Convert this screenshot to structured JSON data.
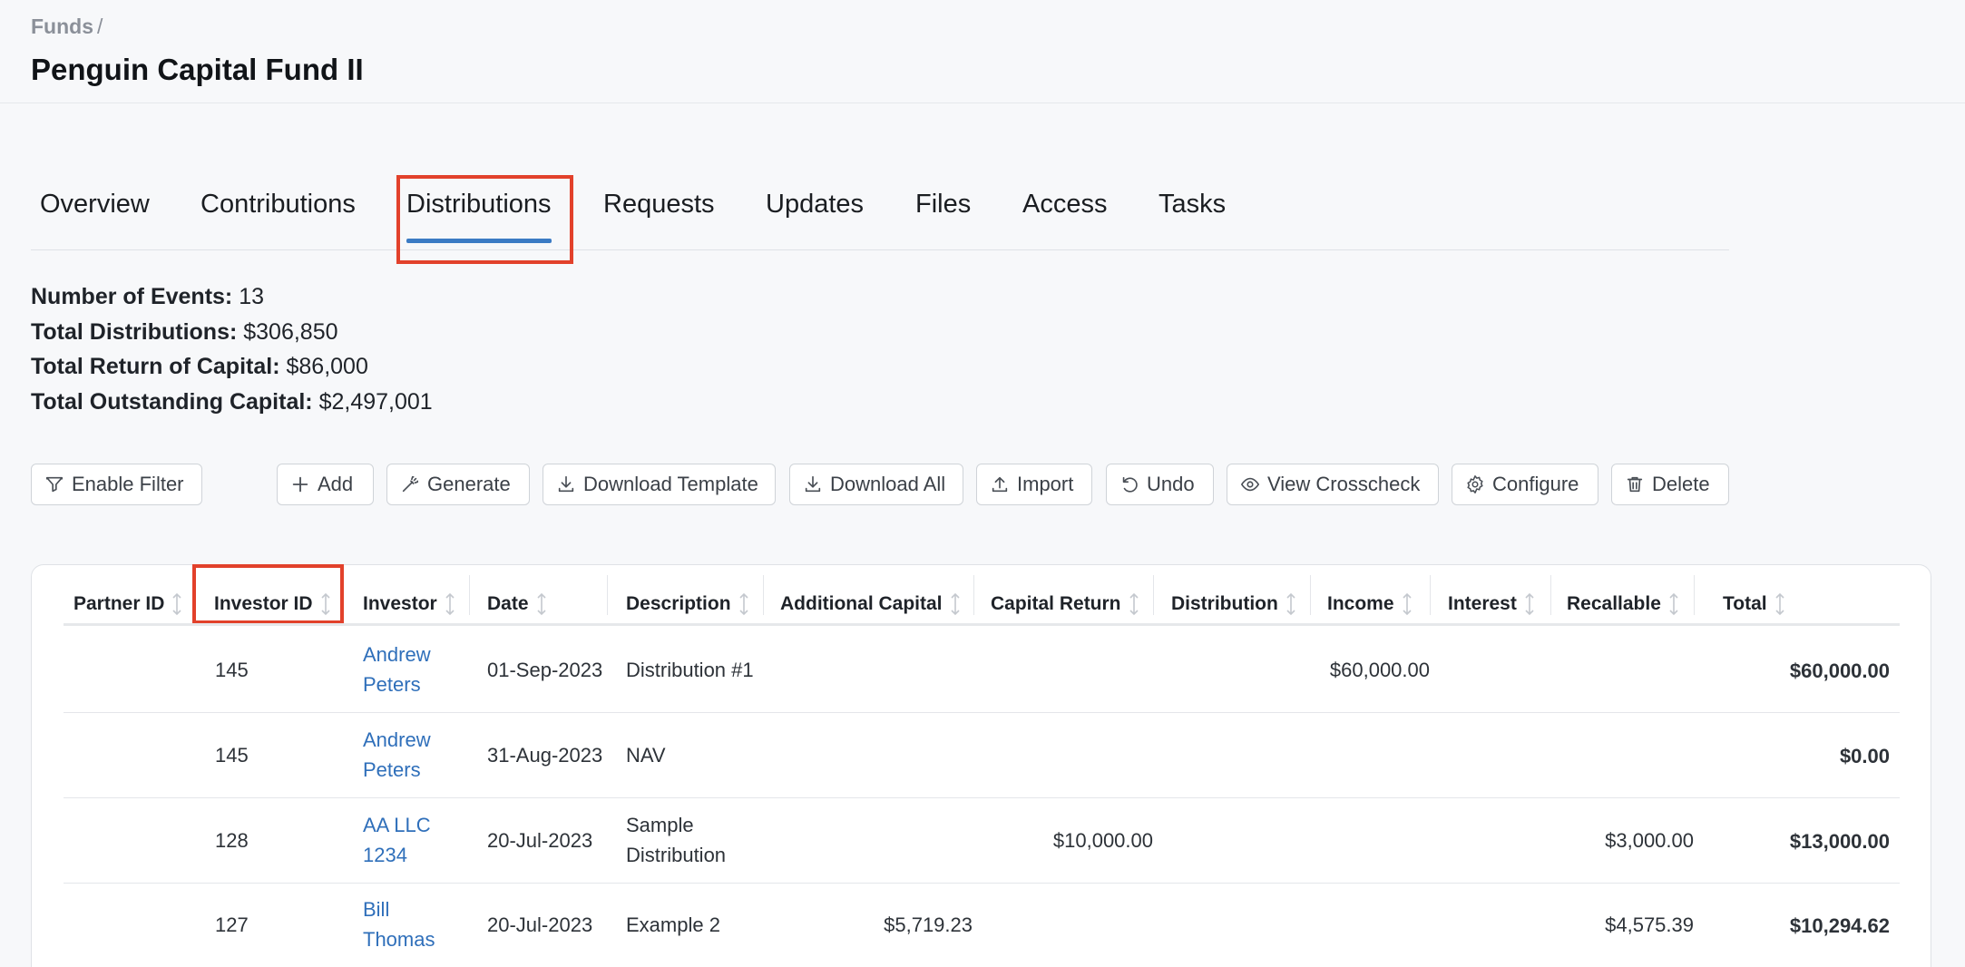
{
  "breadcrumb": {
    "parent": "Funds",
    "separator": "/"
  },
  "page_title": "Penguin Capital Fund II",
  "tabs": [
    {
      "label": "Overview"
    },
    {
      "label": "Contributions"
    },
    {
      "label": "Distributions",
      "active": true
    },
    {
      "label": "Requests"
    },
    {
      "label": "Updates"
    },
    {
      "label": "Files"
    },
    {
      "label": "Access"
    },
    {
      "label": "Tasks"
    }
  ],
  "summary": [
    {
      "label": "Number of Events:",
      "value": "13"
    },
    {
      "label": "Total Distributions:",
      "value": "$306,850"
    },
    {
      "label": "Total Return of Capital:",
      "value": "$86,000"
    },
    {
      "label": "Total Outstanding Capital:",
      "value": "$2,497,001"
    }
  ],
  "toolbar": {
    "enable_filter": "Enable Filter",
    "add": "Add",
    "generate": "Generate",
    "download_template": "Download Template",
    "download_all": "Download All",
    "import": "Import",
    "undo": "Undo",
    "view_crosscheck": "View Crosscheck",
    "configure": "Configure",
    "delete": "Delete"
  },
  "table": {
    "columns": [
      "Partner ID",
      "Investor ID",
      "Investor",
      "Date",
      "Description",
      "Additional Capital",
      "Capital Return",
      "Distribution",
      "Income",
      "Interest",
      "Recallable",
      "Total"
    ],
    "rows": [
      {
        "partner_id": "",
        "investor_id": "145",
        "investor_line1": "Andrew",
        "investor_line2": "Peters",
        "date": "01-Sep-2023",
        "description_line1": "Distribution #1",
        "description_line2": "",
        "additional_capital": "",
        "capital_return": "",
        "distribution": "",
        "income": "$60,000.00",
        "interest": "",
        "recallable": "",
        "total": "$60,000.00"
      },
      {
        "partner_id": "",
        "investor_id": "145",
        "investor_line1": "Andrew",
        "investor_line2": "Peters",
        "date": "31-Aug-2023",
        "description_line1": "NAV",
        "description_line2": "",
        "additional_capital": "",
        "capital_return": "",
        "distribution": "",
        "income": "",
        "interest": "",
        "recallable": "",
        "total": "$0.00"
      },
      {
        "partner_id": "",
        "investor_id": "128",
        "investor_line1": "AA LLC",
        "investor_line2": "1234",
        "date": "20-Jul-2023",
        "description_line1": "Sample",
        "description_line2": "Distribution",
        "additional_capital": "",
        "capital_return": "$10,000.00",
        "distribution": "",
        "income": "",
        "interest": "",
        "recallable": "$3,000.00",
        "total": "$13,000.00"
      },
      {
        "partner_id": "",
        "investor_id": "127",
        "investor_line1": "Bill",
        "investor_line2": "Thomas",
        "date": "20-Jul-2023",
        "description_line1": "Example 2",
        "description_line2": "",
        "additional_capital": "$5,719.23",
        "capital_return": "",
        "distribution": "",
        "income": "",
        "interest": "",
        "recallable": "$4,575.39",
        "total": "$10,294.62"
      }
    ]
  },
  "colors": {
    "accent": "#3b7bc4",
    "link": "#2f6fba",
    "highlight": "#e2412b"
  }
}
